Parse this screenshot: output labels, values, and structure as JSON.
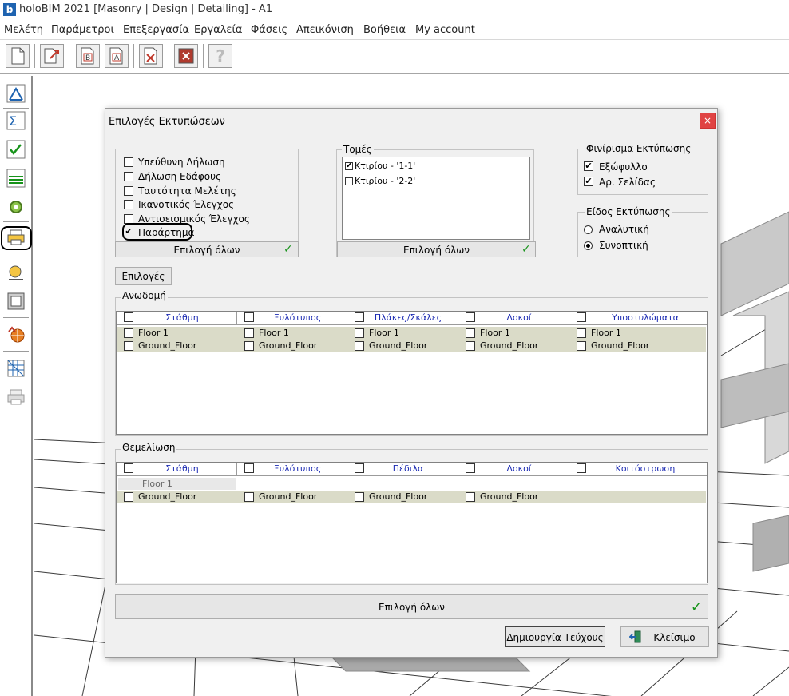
{
  "app": {
    "icon_letter": "b",
    "title": "holoBIM 2021 [Masonry | Design | Detailing] - A1"
  },
  "menu": [
    "Μελέτη",
    "Παράμετροι",
    "Επεξεργασία",
    "Εργαλεία",
    "Φάσεις",
    "Απεικόνιση",
    "Βοήθεια",
    "My account"
  ],
  "toolbar_icons": [
    "new-file-icon",
    "open-export-icon",
    "report-b-icon",
    "report-a-icon",
    "delete-doc-icon",
    "close-box-icon",
    "help-icon"
  ],
  "toolbar_help_glyph": "?",
  "sidebar_icons": [
    "design-check-icon",
    "sum-icon",
    "checklist-icon",
    "layers-icon",
    "gear-icon",
    "printer-icon",
    "measure-icon",
    "frame-icon",
    "globe-export-icon",
    "mesh-icon",
    "print-preview-icon"
  ],
  "dialog": {
    "title": "Επιλογές Εκτυπώσεων",
    "close_glyph": "×",
    "reports": {
      "items": [
        {
          "label": "Υπεύθυνη Δήλωση",
          "checked": false
        },
        {
          "label": "Δήλωση Εδάφους",
          "checked": false
        },
        {
          "label": "Ταυτότητα Μελέτης",
          "checked": false
        },
        {
          "label": "Ικανοτικός Έλεγχος",
          "checked": false
        },
        {
          "label": "Αντισεισμικός Έλεγχος",
          "checked": false
        },
        {
          "label": "Παράρτημα",
          "checked": true
        }
      ],
      "select_all": "Επιλογή όλων"
    },
    "sections": {
      "label": "Τομές",
      "items": [
        {
          "label": "Κτιρίου - '1-1'",
          "checked": true
        },
        {
          "label": "Κτιρίου - '2-2'",
          "checked": false
        }
      ],
      "select_all": "Επιλογή όλων"
    },
    "finishing": {
      "label": "Φινίρισμα Εκτύπωσης",
      "items": [
        {
          "label": "Εξώφυλλο",
          "checked": true
        },
        {
          "label": "Αρ. Σελίδας",
          "checked": true
        }
      ]
    },
    "print_type": {
      "label": "Είδος Εκτύπωσης",
      "options": [
        "Αναλυτική",
        "Συνοπτική"
      ],
      "selected": "Συνοπτική"
    },
    "options_button": "Επιλογές",
    "superstructure": {
      "label": "Ανωδομή",
      "columns": [
        "Στάθμη",
        "Ξυλότυπος",
        "Πλάκες/Σκάλες",
        "Δοκοί",
        "Υποστυλώματα"
      ],
      "rows": [
        "Floor 1",
        "Ground_Floor"
      ]
    },
    "foundation": {
      "label": "Θεμελίωση",
      "columns": [
        "Στάθμη",
        "Ξυλότυπος",
        "Πέδιλα",
        "Δοκοί",
        "Κοιτόστρωση"
      ],
      "floor_label": "Floor 1",
      "rows": [
        "Ground_Floor"
      ]
    },
    "select_all_bottom": "Επιλογή όλων",
    "create_button": "Δημιουργία Τεύχους",
    "close_button": "Κλείσιμο"
  },
  "colors": {
    "accent_check": "#17931a",
    "header_text": "#1c2bb3",
    "row_shade": "#dadbc8",
    "close_red": "#e04343"
  }
}
